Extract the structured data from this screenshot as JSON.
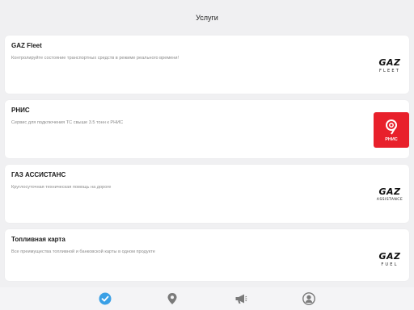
{
  "header": {
    "title": "Услуги"
  },
  "services": [
    {
      "title": "GAZ Fleet",
      "description": "Контролируйте состояние транспортных средств в режиме реального времени!",
      "logo_brand": "GAZ",
      "logo_sub": "FLEET"
    },
    {
      "title": "РНИС",
      "description": "Сервис для подключения ТС свыше 3.5 тонн к РНИС",
      "logo_text": "РНИС"
    },
    {
      "title": "ГАЗ АССИСТАНС",
      "description": "Круглосуточная техническая помощь на дороге",
      "logo_brand": "GAZ",
      "logo_sub": "ASSISTANCE"
    },
    {
      "title": "Топливная карта",
      "description": "Все преимущества топливной и банковской карты в одном продукте",
      "logo_brand": "GAZ",
      "logo_sub": "FUEL"
    }
  ],
  "tabbar": {
    "tabs": [
      {
        "icon": "check-circle-icon",
        "active": true
      },
      {
        "icon": "map-pin-icon",
        "active": false
      },
      {
        "icon": "megaphone-icon",
        "active": false
      },
      {
        "icon": "profile-icon",
        "active": false
      }
    ]
  },
  "colors": {
    "accent": "#3aa0e6",
    "rnis_red": "#e8202b",
    "inactive_icon": "#7a7a7a"
  }
}
